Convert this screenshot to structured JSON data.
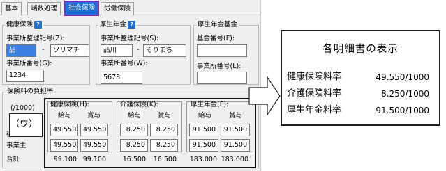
{
  "tabs": [
    {
      "label": "基本"
    },
    {
      "label": "端数処理"
    },
    {
      "label": "社会保険"
    },
    {
      "label": "労働保険"
    }
  ],
  "kenko": {
    "title": "健康保険",
    "help": "?",
    "seiri_label": "事業所整理記号(Z):",
    "seiri_code": "品",
    "seiri_name": "ソリマチ",
    "bango_label": "事業所番号(G):",
    "bango_value": "1234"
  },
  "kosei": {
    "title": "厚生年金",
    "help": "?",
    "seiri_label": "事業所整理記号(S):",
    "seiri_code": "品川",
    "seiri_name": "そりまち",
    "bango_label": "事業所番号(W):",
    "bango_value": "5678"
  },
  "kikin": {
    "title": "厚生年金基金",
    "bango_label": "基金番号(F):",
    "jigyosho_label": "事業所番号(L):"
  },
  "dash": "-",
  "futan": {
    "title": "保険料の負担率",
    "unit": "(/1000)",
    "marker": "（ウ）",
    "row_labels": [
      "被",
      "事業主",
      "合計"
    ],
    "groups": [
      {
        "name": "健康保険(H):",
        "col1": "給与",
        "col2": "賞与",
        "row1": [
          "49.550",
          "49.550"
        ],
        "row2": [
          "49.550",
          "49.550"
        ],
        "total": [
          "99.100",
          "99.100"
        ]
      },
      {
        "name": "介護保険(K):",
        "col1": "給与",
        "col2": "賞与",
        "row1": [
          "8.250",
          "8.250"
        ],
        "row2": [
          "8.250",
          "8.250"
        ],
        "total": [
          "16.500",
          "16.500"
        ]
      },
      {
        "name": "厚生年金(P):",
        "col1": "給与",
        "col2": "賞与",
        "row1": [
          "91.500",
          "91.500"
        ],
        "row2": [
          "91.500",
          "91.500"
        ],
        "total": [
          "183.000",
          "183.000"
        ]
      }
    ]
  },
  "callout": {
    "title": "各明細書の表示",
    "rows": [
      {
        "label": "健康保険料率",
        "value": "49.550/1000"
      },
      {
        "label": "介護保険料率",
        "value": "8.250/1000"
      },
      {
        "label": "厚生年金料率",
        "value": "91.500/1000"
      }
    ]
  },
  "colors": {
    "accent": "#1e6fd9",
    "tab_outline": "#7b2cbf",
    "selected_input": "#3b80e0"
  }
}
